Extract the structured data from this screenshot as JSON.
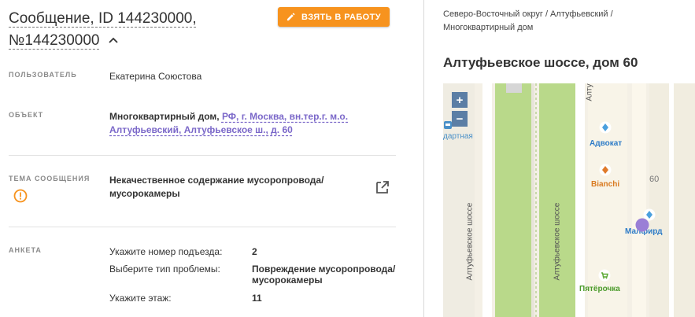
{
  "message": {
    "title_line1": "Сообщение, ID 144230000,",
    "title_line2": "№144230000",
    "take_button": "ВЗЯТЬ В РАБОТУ"
  },
  "fields": {
    "user_label": "ПОЛЬЗОВАТЕЛЬ",
    "user_value": "Екатерина Союстова",
    "object_label": "ОБЪЕКТ",
    "object_type": "Многоквартирный дом,",
    "object_address": "РФ, г. Москва, вн.тер.г. м.о. Алтуфьевский, Алтуфьевское ш., д. 60",
    "topic_label": "ТЕМА СООБЩЕНИЯ",
    "topic_value": "Некачественное содержание мусоропровода/ мусорокамеры"
  },
  "survey": {
    "label": "АНКЕТА",
    "rows": [
      {
        "question": "Укажите номер подъезда:",
        "answer": "2"
      },
      {
        "question": "Выберите тип проблемы:",
        "answer": "Повреждение мусоропровода/ мусорокамеры"
      },
      {
        "question": "Укажите этаж:",
        "answer": "11"
      }
    ]
  },
  "location": {
    "breadcrumb": "Северо-Восточный округ / Алтуфьевский / Многоквартирный дом",
    "address_title": "Алтуфьевское шоссе, дом 60"
  },
  "map": {
    "zoom_in": "+",
    "zoom_out": "−",
    "street_label": "Алтуфьевское шоссе",
    "street_top_label": "Алту",
    "poi_left": "дартная",
    "poi_advokat": "Адвокат",
    "poi_bianchi": "Bianchi",
    "house_number": "60",
    "poi_malfird": "Малфирд",
    "poi_pyaterochka": "Пятёрочка"
  },
  "colors": {
    "accent": "#f7931e",
    "link": "#7b68c9",
    "warning": "#f7931e",
    "map_green": "#b9d98a",
    "marker": "#9a7fd6"
  }
}
